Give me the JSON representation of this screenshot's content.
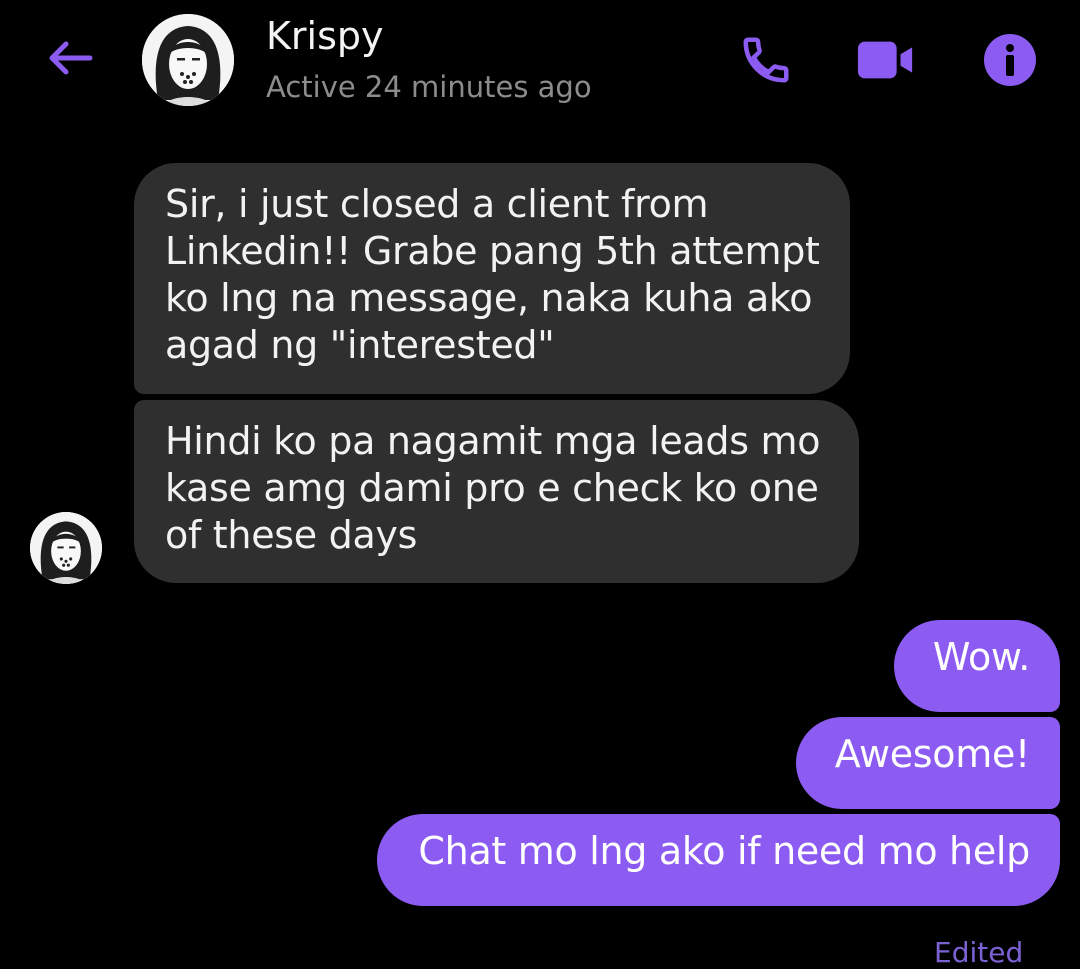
{
  "colors": {
    "accent": "#8c5cf2",
    "background": "#000000",
    "incoming_bubble": "#2f2f2f",
    "status_text": "#8c8c8c"
  },
  "header": {
    "back_icon": "arrow-left-icon",
    "contact_name": "Krispy",
    "status": "Active 24 minutes ago",
    "actions": [
      {
        "icon": "phone-icon"
      },
      {
        "icon": "video-camera-icon"
      },
      {
        "icon": "info-icon"
      }
    ]
  },
  "messages": [
    {
      "direction": "incoming",
      "text": "Sir, i just closed a client from Linkedin!! Grabe pang 5th attempt ko lng na message, naka kuha ako agad ng \"interested\""
    },
    {
      "direction": "incoming",
      "text": "Hindi ko pa nagamit mga leads mo kase amg dami pro e check ko one of these days"
    },
    {
      "direction": "outgoing",
      "text": "Wow."
    },
    {
      "direction": "outgoing",
      "text": "Awesome!"
    },
    {
      "direction": "outgoing",
      "text": "Chat mo lng ako if need mo help"
    }
  ],
  "footer": {
    "edited_label": "Edited"
  }
}
